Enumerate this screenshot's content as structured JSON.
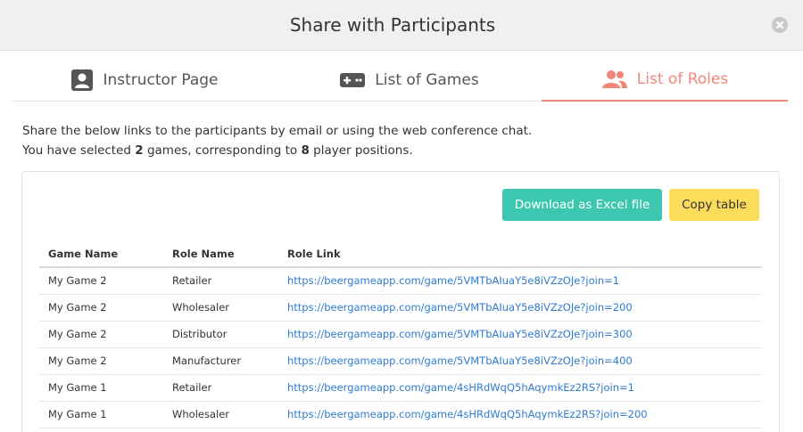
{
  "dialog": {
    "title": "Share with Participants"
  },
  "tabs": [
    {
      "label": "Instructor Page",
      "icon": "user-badge-icon",
      "active": false
    },
    {
      "label": "List of Games",
      "icon": "gamepad-icon",
      "active": false
    },
    {
      "label": "List of Roles",
      "icon": "users-icon",
      "active": true
    }
  ],
  "intro": {
    "line1": "Share the below links to the participants by email or using the web conference chat.",
    "line2_prefix": "You have selected ",
    "games_count": "2",
    "line2_mid": " games, corresponding to ",
    "positions_count": "8",
    "line2_suffix": " player positions."
  },
  "actions": {
    "download_label": "Download as Excel file",
    "copy_label": "Copy table"
  },
  "table": {
    "headers": [
      "Game Name",
      "Role Name",
      "Role Link"
    ],
    "rows": [
      [
        "My Game 2",
        "Retailer",
        "https://beergameapp.com/game/5VMTbAIuaY5e8iVZzOJe?join=1"
      ],
      [
        "My Game 2",
        "Wholesaler",
        "https://beergameapp.com/game/5VMTbAIuaY5e8iVZzOJe?join=200"
      ],
      [
        "My Game 2",
        "Distributor",
        "https://beergameapp.com/game/5VMTbAIuaY5e8iVZzOJe?join=300"
      ],
      [
        "My Game 2",
        "Manufacturer",
        "https://beergameapp.com/game/5VMTbAIuaY5e8iVZzOJe?join=400"
      ],
      [
        "My Game 1",
        "Retailer",
        "https://beergameapp.com/game/4sHRdWqQ5hAqymkEz2RS?join=1"
      ],
      [
        "My Game 1",
        "Wholesaler",
        "https://beergameapp.com/game/4sHRdWqQ5hAqymkEz2RS?join=200"
      ]
    ]
  },
  "colors": {
    "accent": "#f0877b",
    "excel_button": "#3ec7b0",
    "copy_button": "#fddc5c",
    "link": "#2f7bd1"
  }
}
